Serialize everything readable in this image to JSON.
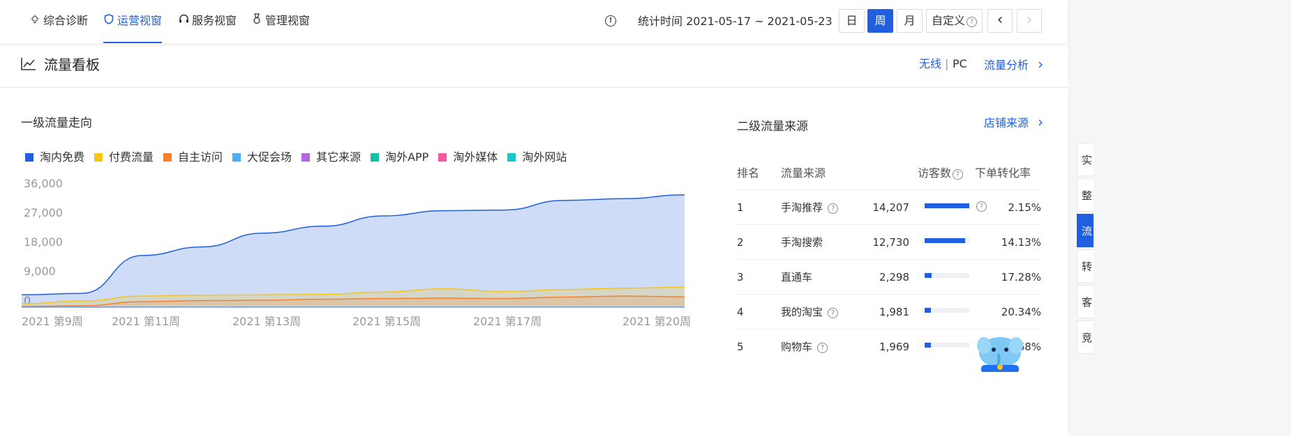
{
  "nav": {
    "tabs": [
      {
        "label": "综合诊断",
        "icon": "bulb-icon"
      },
      {
        "label": "运营视窗",
        "icon": "shield-icon",
        "active": true
      },
      {
        "label": "服务视窗",
        "icon": "headset-icon"
      },
      {
        "label": "管理视窗",
        "icon": "medal-icon"
      }
    ],
    "stat_time": "统计时间 2021-05-17 ~ 2021-05-23",
    "period_buttons": [
      "日",
      "周",
      "月"
    ],
    "custom_label": "自定义",
    "custom_help": "?",
    "prev": "‹",
    "next": "›",
    "info": "!"
  },
  "header": {
    "title": "流量看板",
    "wireless": "无线",
    "separator": "|",
    "pc": "PC",
    "analysis_link": "流量分析",
    "chevron": "›"
  },
  "left": {
    "title": "一级流量走向",
    "legend": [
      {
        "label": "淘内免费",
        "color": "#1f5fe0"
      },
      {
        "label": "付费流量",
        "color": "#f5c518"
      },
      {
        "label": "自主访问",
        "color": "#f77f2e"
      },
      {
        "label": "大促会场",
        "color": "#4eaef5"
      },
      {
        "label": "其它来源",
        "color": "#b565e0"
      },
      {
        "label": "淘外APP",
        "color": "#12c1a0"
      },
      {
        "label": "淘外媒体",
        "color": "#f35aa0"
      },
      {
        "label": "淘外网站",
        "color": "#16c8c8"
      }
    ]
  },
  "chart_data": {
    "type": "area",
    "x": [
      "2021 第9周",
      "2021 第10周",
      "2021 第11周",
      "2021 第12周",
      "2021 第13周",
      "2021 第14周",
      "2021 第15周",
      "2021 第16周",
      "2021 第17周",
      "2021 第18周",
      "2021 第19周",
      "2021 第20周"
    ],
    "x_tick_labels": [
      "2021 第9周",
      "2021 第11周",
      "2021 第13周",
      "2021 第15周",
      "2021 第17周",
      "2021 第20周"
    ],
    "y_tick_labels": [
      "36,000",
      "27,000",
      "18,000",
      "9,000",
      "0"
    ],
    "ylim": [
      0,
      36000
    ],
    "series": [
      {
        "name": "淘内免费",
        "values": [
          3600,
          4000,
          15000,
          17500,
          21500,
          23500,
          26500,
          28000,
          28200,
          31000,
          31500,
          32600
        ],
        "color": "#1f5fe0"
      },
      {
        "name": "付费流量",
        "values": [
          1000,
          1800,
          3200,
          3500,
          3600,
          3700,
          4400,
          5300,
          4500,
          5100,
          5500,
          5800
        ],
        "color": "#f5c518"
      },
      {
        "name": "自主访问",
        "values": [
          200,
          400,
          1600,
          1900,
          2000,
          2300,
          2500,
          2600,
          2500,
          2900,
          3200,
          3000
        ],
        "color": "#f77f2e"
      }
    ]
  },
  "right": {
    "title": "二级流量来源",
    "link": "店铺来源",
    "chevron": "›",
    "headers": {
      "rank": "排名",
      "source": "流量来源",
      "visitors": "访客数",
      "conversion": "下单转化率",
      "help": "?"
    },
    "rows": [
      {
        "rank": "1",
        "source": "手淘推荐",
        "help": true,
        "visitors": "14,207",
        "ratio": 1.0,
        "conversion": "2.15%"
      },
      {
        "rank": "2",
        "source": "手淘搜索",
        "help": false,
        "visitors": "12,730",
        "ratio": 0.9,
        "conversion": "14.13%"
      },
      {
        "rank": "3",
        "source": "直通车",
        "help": false,
        "visitors": "2,298",
        "ratio": 0.16,
        "conversion": "17.28%"
      },
      {
        "rank": "4",
        "source": "我的淘宝",
        "help": true,
        "visitors": "1,981",
        "ratio": 0.14,
        "conversion": "20.34%"
      },
      {
        "rank": "5",
        "source": "购物车",
        "help": true,
        "visitors": "1,969",
        "ratio": 0.14,
        "conversion": "68%"
      }
    ]
  },
  "side_nav": [
    {
      "label": "实"
    },
    {
      "label": "整"
    },
    {
      "label": "流",
      "active": true
    },
    {
      "label": "转"
    },
    {
      "label": "客"
    },
    {
      "label": "竞"
    }
  ]
}
